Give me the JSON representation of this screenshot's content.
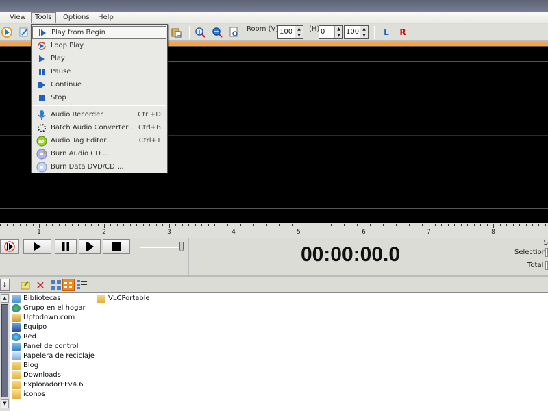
{
  "menubar": {
    "items": [
      {
        "label": "View"
      },
      {
        "label": "Tools"
      },
      {
        "label": "Options"
      },
      {
        "label": "Help"
      }
    ]
  },
  "toolbar": {
    "room_label": "Room (V)",
    "room_v_value": "100",
    "h_label": "(H)",
    "h_value": "0",
    "h_zoom_value": "100",
    "left_channel_label": "L",
    "right_channel_label": "R"
  },
  "tools_menu": {
    "items": [
      {
        "label": "Play from Begin",
        "shortcut": "",
        "icon": "play-from-begin-icon",
        "highlighted": true
      },
      {
        "label": "Loop Play",
        "shortcut": "",
        "icon": "loop-play-icon"
      },
      {
        "label": "Play",
        "shortcut": "",
        "icon": "play-icon"
      },
      {
        "label": "Pause",
        "shortcut": "",
        "icon": "pause-icon"
      },
      {
        "label": "Continue",
        "shortcut": "",
        "icon": "continue-icon"
      },
      {
        "label": "Stop",
        "shortcut": "",
        "icon": "stop-icon"
      },
      {
        "label": "Audio Recorder",
        "shortcut": "Ctrl+D",
        "icon": "microphone-icon"
      },
      {
        "label": "Batch Audio Converter ...",
        "shortcut": "Ctrl+B",
        "icon": "batch-convert-icon"
      },
      {
        "label": "Audio Tag Editor ...",
        "shortcut": "Ctrl+T",
        "icon": "tag-editor-icon"
      },
      {
        "label": "Burn Audio CD ...",
        "shortcut": "",
        "icon": "burn-audio-cd-icon"
      },
      {
        "label": "Burn Data DVD/CD ...",
        "shortcut": "",
        "icon": "burn-data-disc-icon"
      }
    ]
  },
  "ruler": {
    "labels": [
      "1",
      "2",
      "3",
      "4",
      "5",
      "6",
      "7",
      "8"
    ]
  },
  "transport": {
    "time": "00:00:00.0",
    "volume": 1.0
  },
  "selection_panel": {
    "header": "S",
    "selection_label": "Selection",
    "total_label": "Total"
  },
  "files": [
    {
      "name": "Bibliotecas",
      "type": "library"
    },
    {
      "name": "Grupo en el hogar",
      "type": "homegroup"
    },
    {
      "name": "Uptodown.com",
      "type": "user-folder"
    },
    {
      "name": "Equipo",
      "type": "computer"
    },
    {
      "name": "Red",
      "type": "network"
    },
    {
      "name": "Panel de control",
      "type": "control-panel"
    },
    {
      "name": "Papelera de reciclaje",
      "type": "recycle-bin"
    },
    {
      "name": "Blog",
      "type": "folder"
    },
    {
      "name": "Downloads",
      "type": "folder"
    },
    {
      "name": "ExploradorFFv4.6",
      "type": "folder"
    },
    {
      "name": "iconos",
      "type": "folder"
    },
    {
      "name": "VLCPortable",
      "type": "folder"
    }
  ],
  "colors": {
    "accent_orange": "#f7a14d",
    "waveform_bg": "#000000",
    "center_line": "#5a1a1a",
    "channel_L": "#1f60c0",
    "channel_R": "#d01010"
  }
}
